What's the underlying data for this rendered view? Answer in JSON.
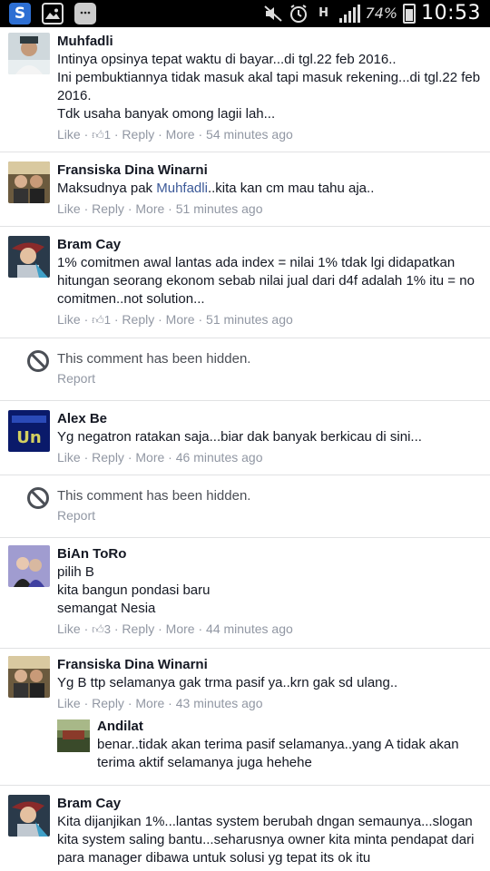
{
  "statusbar": {
    "battery": "74%",
    "time": "10:53",
    "network": "H",
    "battery_level": 0.74
  },
  "actions": {
    "like": "Like",
    "reply": "Reply",
    "more": "More",
    "report": "Report",
    "hidden": "This comment has been hidden."
  },
  "comments": [
    {
      "name": "Muhfadli",
      "text": "Intinya opsinya tepat waktu di bayar...di tgl.22 feb 2016..\nIni pembuktiannya tidak masuk akal tapi masuk rekening...di tgl.22 feb 2016.\nTdk usaha banyak omong lagii lah...",
      "likes": "1",
      "time": "54 minutes ago"
    },
    {
      "name": "Fransiska Dina Winarni",
      "text_pre": "Maksudnya pak ",
      "mention": "Muhfadli",
      "text_post": "..kita kan cm mau tahu aja..",
      "time": "51 minutes ago"
    },
    {
      "name": "Bram Cay",
      "text": "1% comitmen awal lantas ada index = nilai 1% tdak lgi didapatkan hitungan seorang ekonom sebab nilai jual dari d4f adalah 1% itu = no comitmen..not solution...",
      "likes": "1",
      "time": "51 minutes ago"
    },
    {
      "name": "Alex Be",
      "text": "Yg negatron ratakan saja...biar dak banyak berkicau di sini...",
      "time": "46 minutes ago"
    },
    {
      "name": "BiAn ToRo",
      "text": "pilih B\nkita bangun pondasi baru\nsemangat Nesia",
      "likes": "3",
      "time": "44 minutes ago"
    },
    {
      "name": "Fransiska Dina Winarni",
      "text": "Yg B ttp selamanya gak trma pasif ya..krn gak sd ulang..",
      "time": "43 minutes ago",
      "reply": {
        "name": "Andilat",
        "text": "benar..tidak akan terima pasif selamanya..yang A tidak akan terima aktif selamanya juga hehehe"
      }
    },
    {
      "name": "Bram Cay",
      "text": "Kita dijanjikan 1%...lantas system berubah dngan semaunya...slogan kita system saling bantu...seharusnya owner kita minta pendapat dari para manager dibawa untuk solusi yg tepat its ok itu"
    }
  ]
}
